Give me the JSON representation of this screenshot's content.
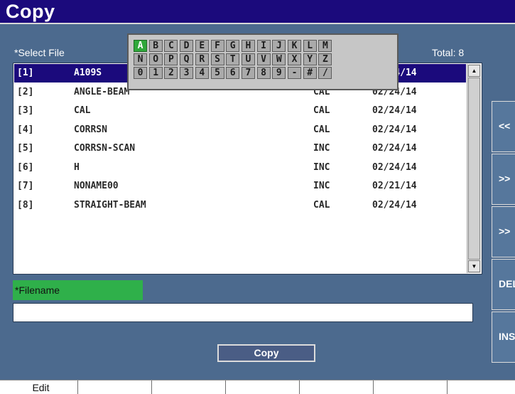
{
  "title": "Copy",
  "select_file_label": "*Select File",
  "total_label": "Total: 8",
  "files": [
    {
      "index": "[1]",
      "name": "A109S",
      "type": "",
      "date": "02/24/14"
    },
    {
      "index": "[2]",
      "name": "ANGLE-BEAM",
      "type": "CAL",
      "date": "02/24/14"
    },
    {
      "index": "[3]",
      "name": "CAL",
      "type": "CAL",
      "date": "02/24/14"
    },
    {
      "index": "[4]",
      "name": "CORRSN",
      "type": "CAL",
      "date": "02/24/14"
    },
    {
      "index": "[5]",
      "name": "CORRSN-SCAN",
      "type": "INC",
      "date": "02/24/14"
    },
    {
      "index": "[6]",
      "name": "H",
      "type": "INC",
      "date": "02/24/14"
    },
    {
      "index": "[7]",
      "name": "NONAME00",
      "type": "INC",
      "date": "02/21/14"
    },
    {
      "index": "[8]",
      "name": "STRAIGHT-BEAM",
      "type": "CAL",
      "date": "02/24/14"
    }
  ],
  "keyboard": {
    "rows": [
      [
        "A",
        "B",
        "C",
        "D",
        "E",
        "F",
        "G",
        "H",
        "I",
        "J",
        "K",
        "L",
        "M"
      ],
      [
        "N",
        "O",
        "P",
        "Q",
        "R",
        "S",
        "T",
        "U",
        "V",
        "W",
        "X",
        "Y",
        "Z"
      ],
      [
        "0",
        "1",
        "2",
        "3",
        "4",
        "5",
        "6",
        "7",
        "8",
        "9",
        "-",
        "#",
        "/"
      ]
    ],
    "active_key": "A"
  },
  "filename_label": "*Filename",
  "filename_value": "",
  "copy_button_label": "Copy",
  "side_buttons": [
    "<<",
    ">>",
    ">>",
    "DEL",
    "INS"
  ],
  "function_keys": [
    "Edit",
    "",
    "",
    "",
    "",
    "",
    ""
  ],
  "scroll_up_symbol": "▲",
  "scroll_down_symbol": "▼"
}
